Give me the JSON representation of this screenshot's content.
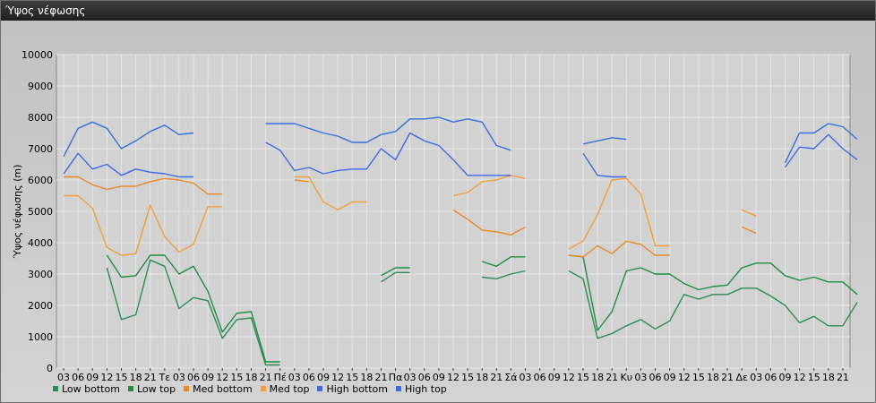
{
  "window": {
    "title": "Ύψος νέφωσης"
  },
  "chart_data": {
    "type": "line",
    "ylabel": "Ύψος νέφωσης (m)",
    "ylim": [
      0,
      10000
    ],
    "yticks": [
      0,
      1000,
      2000,
      3000,
      4000,
      5000,
      6000,
      7000,
      8000,
      9000,
      10000
    ],
    "grid": true,
    "legend": "bottom-left",
    "categories": [
      "03",
      "06",
      "09",
      "12",
      "15",
      "18",
      "21",
      "Τε",
      "03",
      "06",
      "09",
      "12",
      "15",
      "18",
      "21",
      "Πέ",
      "03",
      "06",
      "09",
      "12",
      "15",
      "18",
      "21",
      "Πα",
      "03",
      "06",
      "09",
      "12",
      "15",
      "18",
      "21",
      "Σά",
      "03",
      "06",
      "09",
      "12",
      "15",
      "18",
      "21",
      "Κυ",
      "03",
      "06",
      "09",
      "12",
      "15",
      "18",
      "21",
      "Δε",
      "03",
      "06",
      "09",
      "12",
      "15",
      "18",
      "21"
    ],
    "series": [
      {
        "name": "Low bottom",
        "color": "#2e8b57",
        "values": [
          null,
          null,
          null,
          3200,
          1550,
          1700,
          3450,
          3250,
          1900,
          2250,
          2150,
          950,
          1550,
          1600,
          100,
          100,
          null,
          null,
          null,
          null,
          null,
          null,
          2750,
          3050,
          3050,
          null,
          null,
          null,
          null,
          2900,
          2850,
          3000,
          3100,
          null,
          null,
          3100,
          2850,
          950,
          1100,
          1350,
          1550,
          1250,
          1500,
          2350,
          2200,
          2350,
          2350,
          2550,
          2550,
          2300,
          2000,
          1450,
          1650,
          1350,
          1350,
          2100
        ]
      },
      {
        "name": "Low top",
        "color": "#238b45",
        "values": [
          null,
          null,
          null,
          3600,
          2900,
          2950,
          3600,
          3600,
          3000,
          3250,
          2450,
          1150,
          1750,
          1800,
          200,
          200,
          null,
          null,
          null,
          null,
          null,
          null,
          2950,
          3200,
          3200,
          null,
          null,
          null,
          null,
          3400,
          3250,
          3550,
          3550,
          null,
          null,
          3600,
          3550,
          1200,
          1800,
          3100,
          3200,
          3000,
          3000,
          2700,
          2500,
          2600,
          2650,
          3200,
          3350,
          3350,
          2950,
          2800,
          2900,
          2750,
          2750,
          2350
        ]
      },
      {
        "name": "Med bottom",
        "color": "#e8892b",
        "values": [
          6100,
          6100,
          5850,
          5700,
          5800,
          5800,
          5950,
          6050,
          6000,
          5900,
          5550,
          5550,
          null,
          null,
          null,
          null,
          6000,
          5950,
          null,
          null,
          null,
          null,
          null,
          null,
          null,
          null,
          null,
          5050,
          4750,
          4400,
          4350,
          4250,
          4500,
          null,
          null,
          3600,
          3550,
          3900,
          3650,
          4050,
          3950,
          3600,
          3600,
          null,
          null,
          null,
          null,
          4500,
          4300,
          null,
          null,
          null,
          null,
          null,
          null,
          null
        ]
      },
      {
        "name": "Med top",
        "color": "#f0a040",
        "values": [
          5500,
          5500,
          5100,
          3850,
          3600,
          3650,
          5200,
          4200,
          3700,
          3950,
          5150,
          5150,
          null,
          null,
          null,
          null,
          6100,
          6100,
          5300,
          5050,
          5300,
          5300,
          null,
          null,
          null,
          null,
          null,
          5500,
          5600,
          5950,
          6000,
          6150,
          6050,
          null,
          null,
          3800,
          4050,
          4900,
          6000,
          6050,
          5550,
          3900,
          3900,
          null,
          null,
          null,
          null,
          5050,
          4850,
          null,
          null,
          null,
          null,
          null,
          null,
          null
        ]
      },
      {
        "name": "High bottom",
        "color": "#4169e1",
        "values": [
          6200,
          6850,
          6350,
          6500,
          6150,
          6350,
          6250,
          6200,
          6100,
          6100,
          null,
          null,
          null,
          null,
          7200,
          6950,
          6300,
          6400,
          6200,
          6300,
          6350,
          6350,
          7000,
          6650,
          7500,
          7250,
          7100,
          6650,
          6150,
          6150,
          6150,
          6150,
          null,
          null,
          null,
          null,
          6850,
          6150,
          6100,
          6100,
          null,
          null,
          null,
          null,
          null,
          null,
          null,
          null,
          null,
          null,
          6400,
          7050,
          7000,
          7450,
          7000,
          6650
        ]
      },
      {
        "name": "High top",
        "color": "#3a6fd8",
        "values": [
          6750,
          7650,
          7850,
          7650,
          7000,
          7250,
          7550,
          7750,
          7450,
          7500,
          null,
          null,
          null,
          null,
          7800,
          7800,
          7800,
          7650,
          7500,
          7400,
          7200,
          7200,
          7450,
          7550,
          7950,
          7950,
          8000,
          7850,
          7950,
          7850,
          7100,
          6950,
          null,
          null,
          null,
          null,
          7150,
          7250,
          7350,
          7300,
          null,
          null,
          null,
          null,
          null,
          null,
          null,
          null,
          null,
          null,
          6550,
          7500,
          7500,
          7800,
          7700,
          7300
        ]
      }
    ]
  }
}
